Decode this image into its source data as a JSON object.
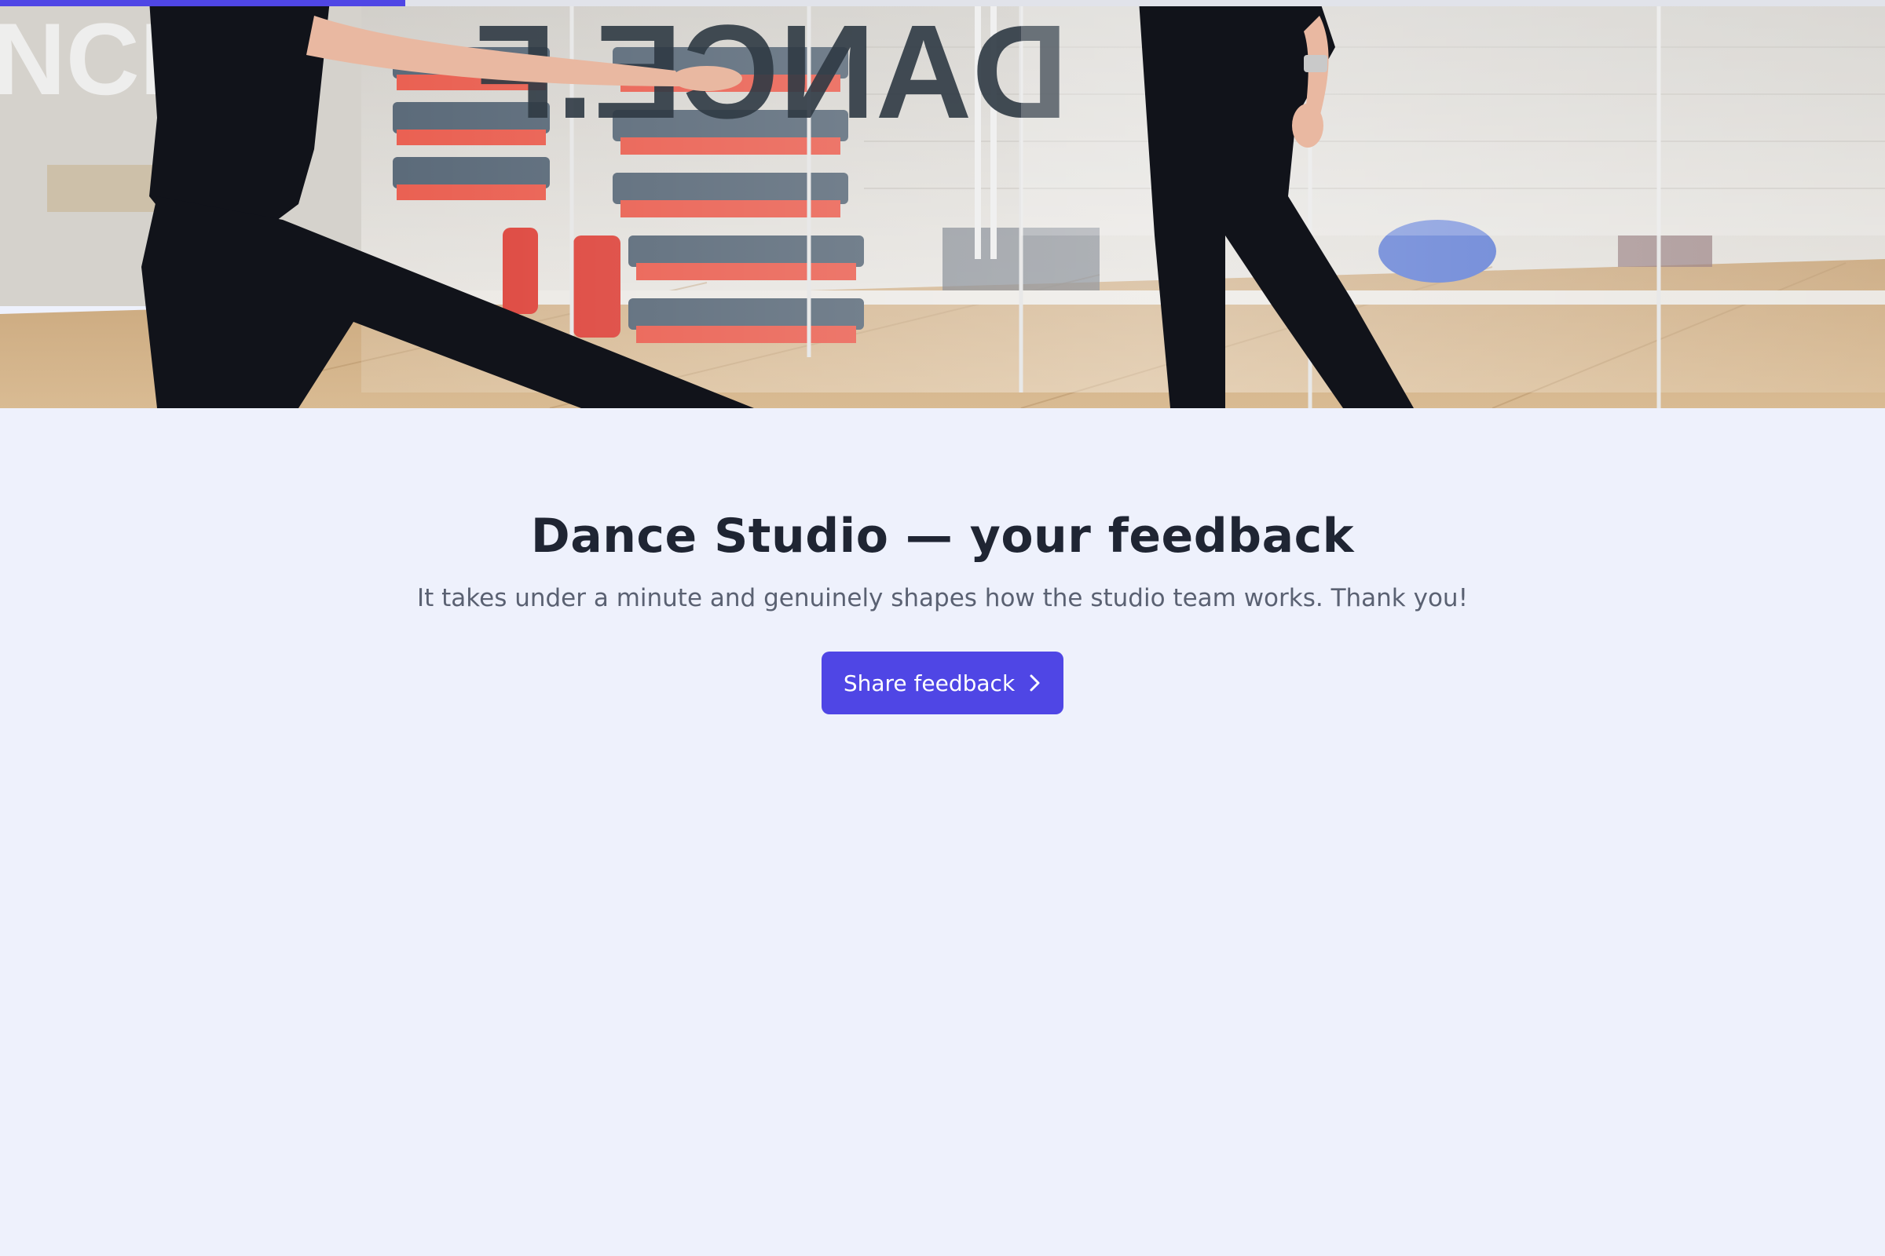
{
  "progress": {
    "fraction": 0.215,
    "color": "#4f46e5"
  },
  "hero": {
    "image_desc": "Photo of dancers in black practicing in a studio with glass walls, mirrors, wooden floor, and stacked red fitness steps",
    "mirror_text": "DANCE.F"
  },
  "survey": {
    "title": "Dance Studio — your feedback",
    "subtitle": "It takes under a minute and genuinely shapes how the studio team works. Thank you!",
    "cta_label": "Share feedback",
    "cta_icon": "chevron-right-icon"
  },
  "colors": {
    "background": "#eef1fc",
    "accent": "#4f46e5",
    "title": "#1f2533",
    "subtitle": "#5a6172"
  }
}
